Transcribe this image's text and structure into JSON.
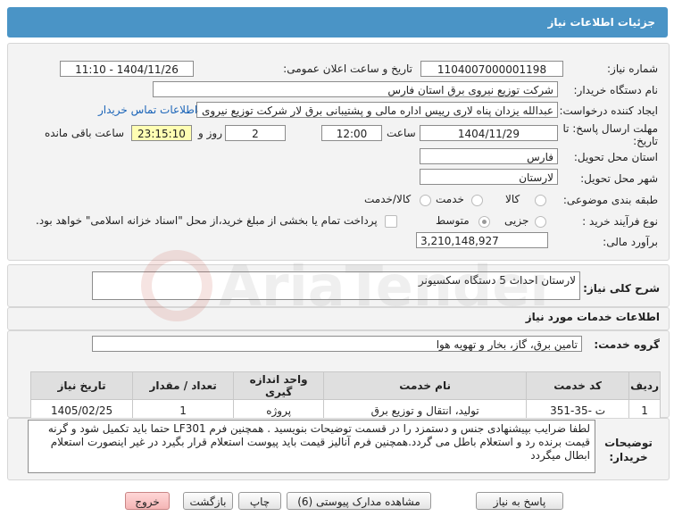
{
  "header": {
    "title": "جزئیات اطلاعات نیاز"
  },
  "form": {
    "need_number_label": "شماره نیاز:",
    "need_number": "1104007000001198",
    "announce_label": "تاریخ و ساعت اعلان عمومی:",
    "announce_value": "1404/11/26 - 11:10",
    "buyer_org_label": "نام دستگاه خریدار:",
    "buyer_org": "شرکت توزیع نیروی برق استان فارس",
    "creator_label": "ایجاد کننده درخواست:",
    "creator": "عبدالله یزدان پناه لاری رییس اداره مالی و پشتیبانی برق لار شرکت توزیع نیروی ب",
    "contact_link": "اطلاعات تماس خریدار",
    "deadline_label": "مهلت ارسال پاسخ: تا تاریخ:",
    "deadline_date": "1404/11/29",
    "time_label": "ساعت",
    "deadline_time": "12:00",
    "days_value": "2",
    "days_label": "روز و",
    "remaining_time": "23:15:10",
    "remaining_label": "ساعت باقی مانده",
    "province_label": "استان محل تحویل:",
    "province": "فارس",
    "city_label": "شهر محل تحویل:",
    "city": "لارستان",
    "category_label": "طبقه بندی موضوعی:",
    "category_options": [
      "کالا",
      "خدمت",
      "کالا/خدمت"
    ],
    "process_label": "نوع فرآیند خرید :",
    "process_options": [
      "جزیی",
      "متوسط"
    ],
    "payment_note": "پرداخت تمام یا بخشی از مبلغ خرید،از محل \"اسناد خزانه اسلامی\" خواهد بود.",
    "estimate_label": "برآورد مالی:",
    "estimate": "3,210,148,927"
  },
  "summary": {
    "label": "شرح کلی نیاز:",
    "value": "لارستان احداث 5 دستگاه سکسیونر"
  },
  "services": {
    "section_title": "اطلاعات خدمات مورد نیاز",
    "group_label": "گروه خدمت:",
    "group_value": "تامین برق، گاز، بخار و تهویه هوا",
    "columns": [
      "ردیف",
      "کد خدمت",
      "نام خدمت",
      "واحد اندازه گیری",
      "تعداد / مقدار",
      "تاریخ نیاز"
    ],
    "rows": [
      {
        "row": "1",
        "code": "ت -35-351",
        "name": "تولید، انتقال و توزیع برق",
        "unit": "پروژه",
        "qty": "1",
        "date": "1405/02/25"
      }
    ]
  },
  "buyer_notes": {
    "label": "توضیحات خریدار:",
    "text": "لطفا ضرایب بپیشنهادی جنس و دستمزد را در قسمت توضیحات بنویسید . همچنین فرم LF301 حتما باید تکمیل شود و گرنه قیمت برنده رد و استعلام باطل می گردد.همچنین فرم آنالیز قیمت باید پیوست استعلام قرار بگیرد در غیر اینصورت استعلام ابطال میگردد"
  },
  "buttons": {
    "reply": "پاسخ به نیاز",
    "attachments": "مشاهده مدارک پیوستی (6)",
    "print": "چاپ",
    "back": "بازگشت",
    "exit": "خروج"
  },
  "colors": {
    "header_bg": "#4a94c6",
    "remaining_bg": "#fffeb3",
    "link": "#1a64b8",
    "exit_bg": "#f5b5b5"
  }
}
